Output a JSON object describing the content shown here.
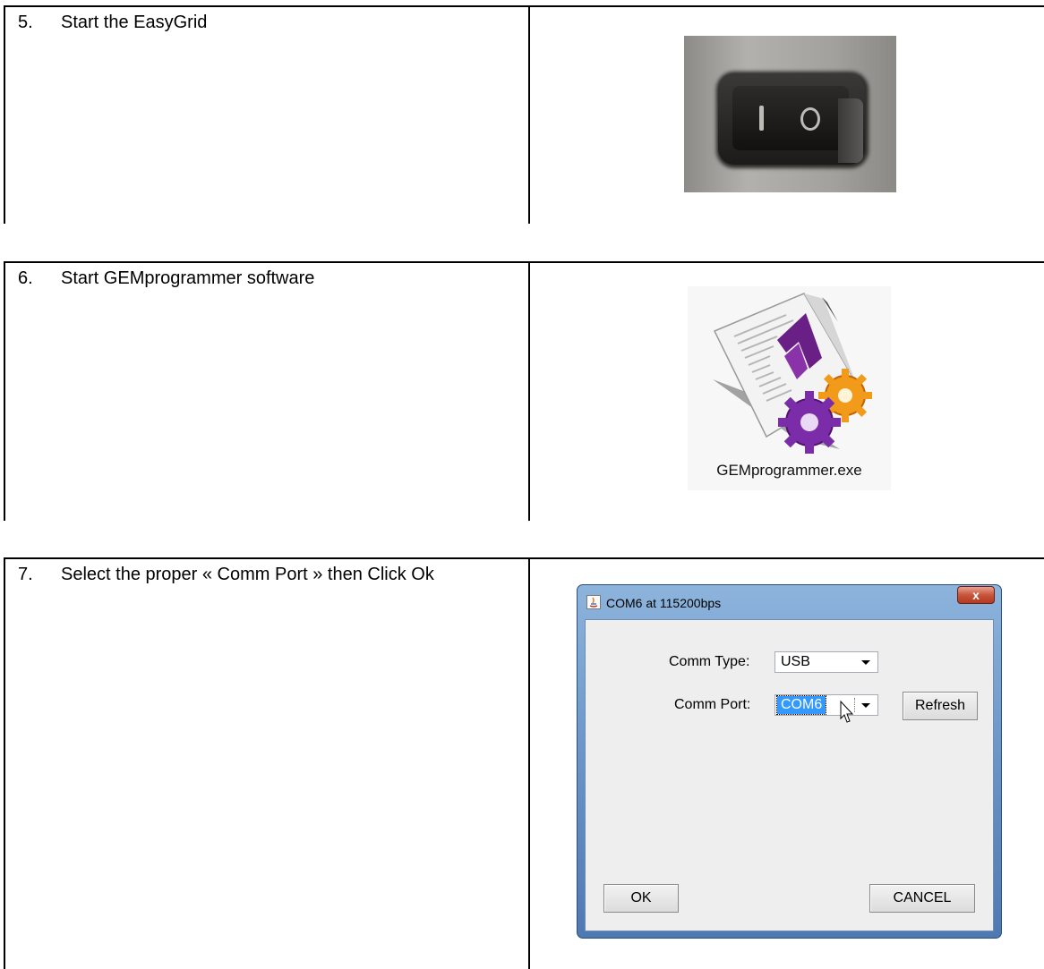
{
  "steps": [
    {
      "number": "5.",
      "text": "Start the EasyGrid"
    },
    {
      "number": "6.",
      "text": "Start GEMprogrammer software"
    },
    {
      "number": "7.",
      "text": "Select the proper « Comm Port » then Click Ok"
    }
  ],
  "icon_file": {
    "caption": "GEMprogrammer.exe"
  },
  "dialog": {
    "title": "COM6 at 115200bps",
    "close_label": "x",
    "comm_type_label": "Comm Type:",
    "comm_type_value": "USB",
    "comm_port_label": "Comm Port:",
    "comm_port_value": "COM6",
    "refresh_label": "Refresh",
    "ok_label": "OK",
    "cancel_label": "CANCEL"
  },
  "colors": {
    "selection": "#3399ff",
    "close_button": "#c7553c",
    "dialog_frame": "#6d97c9",
    "gear_purple": "#7b2ca8",
    "gear_orange": "#f29a1a"
  }
}
